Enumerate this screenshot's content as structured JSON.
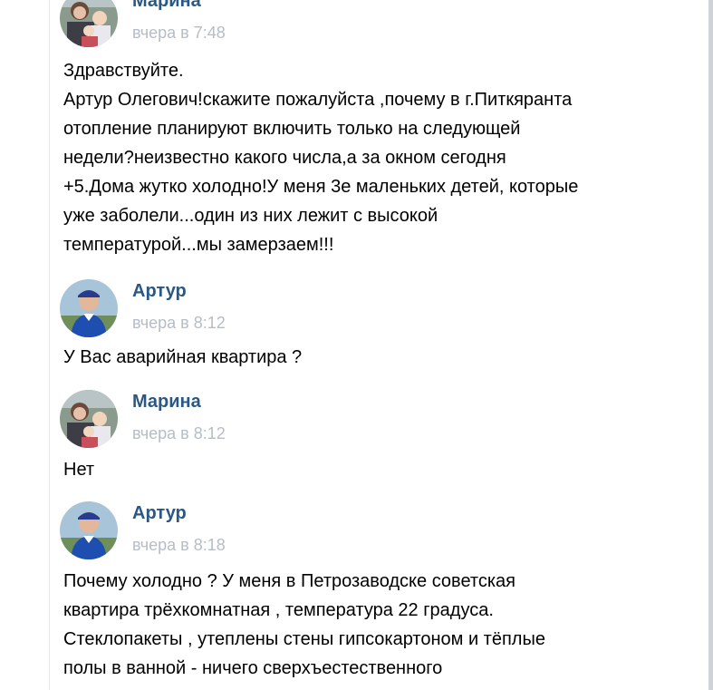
{
  "conversation": {
    "messages": [
      {
        "author": "Марина",
        "time": "вчера в 7:48",
        "text": "Здравствуйте.\nАртур Олегович!скажите пожалуйста ,почему в г.Питкяранта\nотопление планируют включить только на следующей\nнедели?неизвестно какого числа,а за окном сегодня\n+5.Дома жутко холодно!У меня 3е маленьких детей, которые\nуже заболели...один из них лежит с высокой\nтемпературой...мы замерзаем!!!"
      },
      {
        "author": "Артур",
        "time": "вчера в 8:12",
        "text": "У Вас аварийная квартира ?"
      },
      {
        "author": "Марина",
        "time": "вчера в 8:12",
        "text": "Нет"
      },
      {
        "author": "Артур",
        "time": "вчера в 8:18",
        "text": "Почему холодно ? У меня в Петрозаводске советская\nквартира трёхкомнатная , температура 22 градуса.\nСтеклопакеты , утеплены стены гипсокартоном и тёплые\nполы в ванной - ничего сверхъестественного"
      }
    ]
  },
  "colors": {
    "author_name": "#2a5885",
    "timestamp": "#b6bdc6",
    "message_text": "#000000"
  },
  "icons": {
    "marina_avatar": "avatar-photo-woman-with-children",
    "artur_avatar": "avatar-photo-man-in-blue-jacket"
  }
}
